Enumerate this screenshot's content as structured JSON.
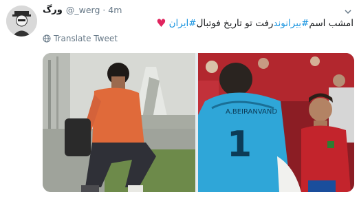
{
  "author": {
    "name": "ورگ",
    "handle": "@_werg",
    "separator": "·",
    "time": "4m"
  },
  "tweet": {
    "text_plain_1": "امشب اسم ",
    "hashtag_1": "#بیرانوند",
    "text_plain_2": " رفت تو تاریخ فوتبال ",
    "hashtag_2": "#ایران",
    "heart": "♥"
  },
  "actions": {
    "translate_label": "Translate Tweet"
  },
  "media": {
    "jersey_text": "A.BEIRANVAND",
    "jersey_number": "1"
  },
  "colors": {
    "hashtag": "#1b95e0",
    "muted": "#657786",
    "heart": "#e0245e"
  }
}
